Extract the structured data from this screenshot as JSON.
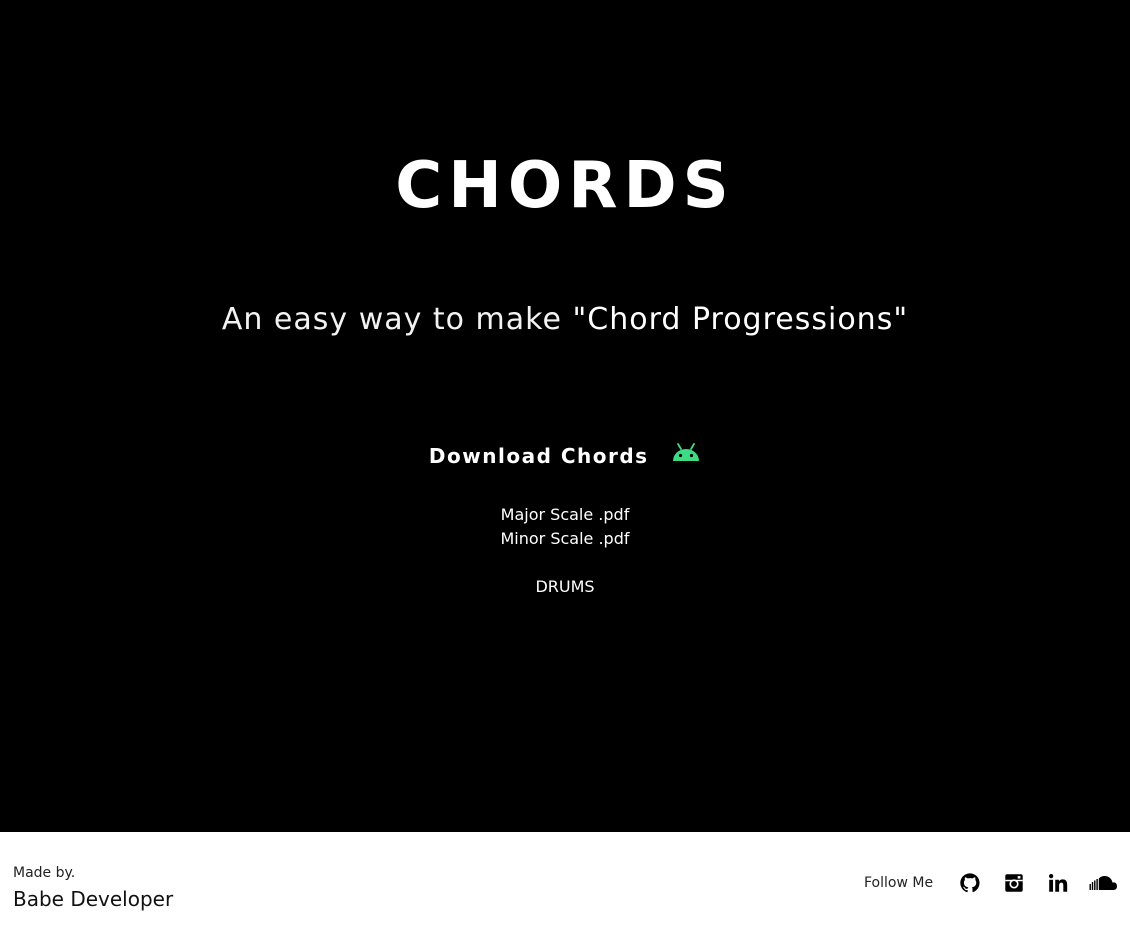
{
  "hero": {
    "title": "CHORDS",
    "subtitle_light": "An easy way to make ",
    "subtitle_strong": "\"Chord Progressions\"",
    "download_label": "Download Chords",
    "download_icon": "android-icon",
    "android_color": "#3ddc84",
    "files": [
      {
        "label": "Major Scale .pdf"
      },
      {
        "label": "Minor Scale .pdf"
      }
    ],
    "drums_label": "DRUMS",
    "background": "#000000",
    "text_color": "#ffffff"
  },
  "footer": {
    "made_by_label": "Made by.",
    "developer_name": "Babe Developer",
    "follow_label": "Follow Me",
    "social": [
      {
        "icon": "github-icon"
      },
      {
        "icon": "instagram-icon"
      },
      {
        "icon": "linkedin-icon"
      },
      {
        "icon": "soundcloud-icon"
      }
    ],
    "background": "#ffffff"
  }
}
